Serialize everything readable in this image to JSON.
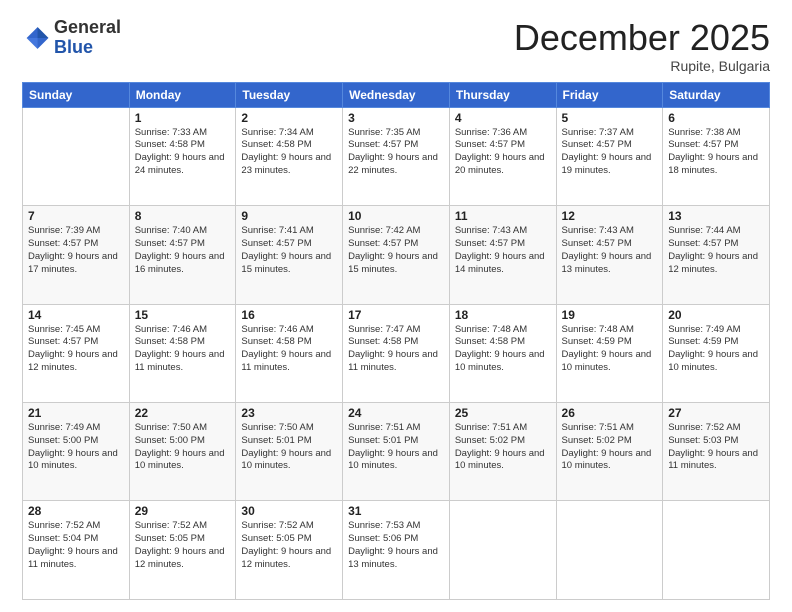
{
  "logo": {
    "general": "General",
    "blue": "Blue"
  },
  "header": {
    "month": "December 2025",
    "location": "Rupite, Bulgaria"
  },
  "weekdays": [
    "Sunday",
    "Monday",
    "Tuesday",
    "Wednesday",
    "Thursday",
    "Friday",
    "Saturday"
  ],
  "weeks": [
    [
      {
        "day": "",
        "info": ""
      },
      {
        "day": "1",
        "info": "Sunrise: 7:33 AM\nSunset: 4:58 PM\nDaylight: 9 hours\nand 24 minutes."
      },
      {
        "day": "2",
        "info": "Sunrise: 7:34 AM\nSunset: 4:58 PM\nDaylight: 9 hours\nand 23 minutes."
      },
      {
        "day": "3",
        "info": "Sunrise: 7:35 AM\nSunset: 4:57 PM\nDaylight: 9 hours\nand 22 minutes."
      },
      {
        "day": "4",
        "info": "Sunrise: 7:36 AM\nSunset: 4:57 PM\nDaylight: 9 hours\nand 20 minutes."
      },
      {
        "day": "5",
        "info": "Sunrise: 7:37 AM\nSunset: 4:57 PM\nDaylight: 9 hours\nand 19 minutes."
      },
      {
        "day": "6",
        "info": "Sunrise: 7:38 AM\nSunset: 4:57 PM\nDaylight: 9 hours\nand 18 minutes."
      }
    ],
    [
      {
        "day": "7",
        "info": "Sunrise: 7:39 AM\nSunset: 4:57 PM\nDaylight: 9 hours\nand 17 minutes."
      },
      {
        "day": "8",
        "info": "Sunrise: 7:40 AM\nSunset: 4:57 PM\nDaylight: 9 hours\nand 16 minutes."
      },
      {
        "day": "9",
        "info": "Sunrise: 7:41 AM\nSunset: 4:57 PM\nDaylight: 9 hours\nand 15 minutes."
      },
      {
        "day": "10",
        "info": "Sunrise: 7:42 AM\nSunset: 4:57 PM\nDaylight: 9 hours\nand 15 minutes."
      },
      {
        "day": "11",
        "info": "Sunrise: 7:43 AM\nSunset: 4:57 PM\nDaylight: 9 hours\nand 14 minutes."
      },
      {
        "day": "12",
        "info": "Sunrise: 7:43 AM\nSunset: 4:57 PM\nDaylight: 9 hours\nand 13 minutes."
      },
      {
        "day": "13",
        "info": "Sunrise: 7:44 AM\nSunset: 4:57 PM\nDaylight: 9 hours\nand 12 minutes."
      }
    ],
    [
      {
        "day": "14",
        "info": "Sunrise: 7:45 AM\nSunset: 4:57 PM\nDaylight: 9 hours\nand 12 minutes."
      },
      {
        "day": "15",
        "info": "Sunrise: 7:46 AM\nSunset: 4:58 PM\nDaylight: 9 hours\nand 11 minutes."
      },
      {
        "day": "16",
        "info": "Sunrise: 7:46 AM\nSunset: 4:58 PM\nDaylight: 9 hours\nand 11 minutes."
      },
      {
        "day": "17",
        "info": "Sunrise: 7:47 AM\nSunset: 4:58 PM\nDaylight: 9 hours\nand 11 minutes."
      },
      {
        "day": "18",
        "info": "Sunrise: 7:48 AM\nSunset: 4:58 PM\nDaylight: 9 hours\nand 10 minutes."
      },
      {
        "day": "19",
        "info": "Sunrise: 7:48 AM\nSunset: 4:59 PM\nDaylight: 9 hours\nand 10 minutes."
      },
      {
        "day": "20",
        "info": "Sunrise: 7:49 AM\nSunset: 4:59 PM\nDaylight: 9 hours\nand 10 minutes."
      }
    ],
    [
      {
        "day": "21",
        "info": "Sunrise: 7:49 AM\nSunset: 5:00 PM\nDaylight: 9 hours\nand 10 minutes."
      },
      {
        "day": "22",
        "info": "Sunrise: 7:50 AM\nSunset: 5:00 PM\nDaylight: 9 hours\nand 10 minutes."
      },
      {
        "day": "23",
        "info": "Sunrise: 7:50 AM\nSunset: 5:01 PM\nDaylight: 9 hours\nand 10 minutes."
      },
      {
        "day": "24",
        "info": "Sunrise: 7:51 AM\nSunset: 5:01 PM\nDaylight: 9 hours\nand 10 minutes."
      },
      {
        "day": "25",
        "info": "Sunrise: 7:51 AM\nSunset: 5:02 PM\nDaylight: 9 hours\nand 10 minutes."
      },
      {
        "day": "26",
        "info": "Sunrise: 7:51 AM\nSunset: 5:02 PM\nDaylight: 9 hours\nand 10 minutes."
      },
      {
        "day": "27",
        "info": "Sunrise: 7:52 AM\nSunset: 5:03 PM\nDaylight: 9 hours\nand 11 minutes."
      }
    ],
    [
      {
        "day": "28",
        "info": "Sunrise: 7:52 AM\nSunset: 5:04 PM\nDaylight: 9 hours\nand 11 minutes."
      },
      {
        "day": "29",
        "info": "Sunrise: 7:52 AM\nSunset: 5:05 PM\nDaylight: 9 hours\nand 12 minutes."
      },
      {
        "day": "30",
        "info": "Sunrise: 7:52 AM\nSunset: 5:05 PM\nDaylight: 9 hours\nand 12 minutes."
      },
      {
        "day": "31",
        "info": "Sunrise: 7:53 AM\nSunset: 5:06 PM\nDaylight: 9 hours\nand 13 minutes."
      },
      {
        "day": "",
        "info": ""
      },
      {
        "day": "",
        "info": ""
      },
      {
        "day": "",
        "info": ""
      }
    ]
  ]
}
